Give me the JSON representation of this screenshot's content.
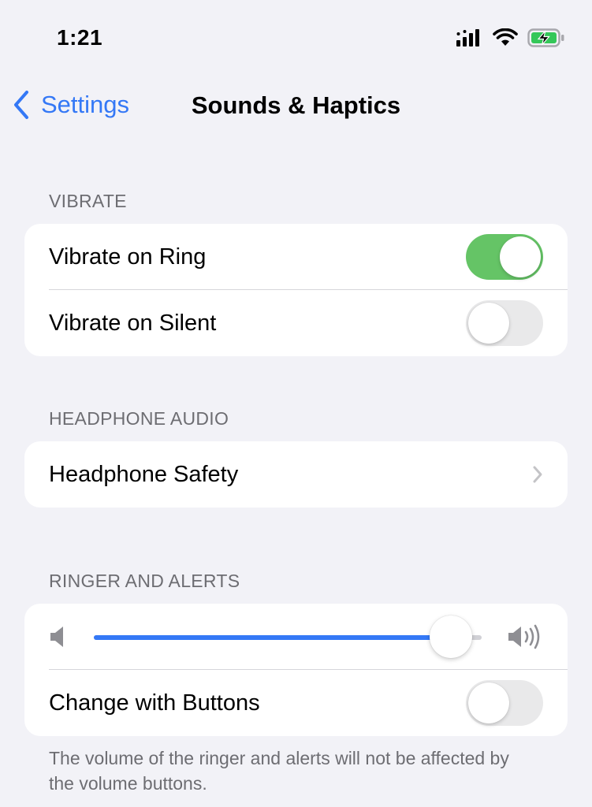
{
  "status_bar": {
    "time": "1:21",
    "icons": [
      "signal-icon",
      "wifi-icon",
      "battery-charging-icon"
    ],
    "battery_color": "#34c759"
  },
  "nav": {
    "back_label": "Settings",
    "title": "Sounds & Haptics"
  },
  "sections": {
    "vibrate": {
      "header": "VIBRATE",
      "rows": [
        {
          "label": "Vibrate on Ring",
          "toggle": true
        },
        {
          "label": "Vibrate on Silent",
          "toggle": false
        }
      ]
    },
    "headphone_audio": {
      "header": "HEADPHONE AUDIO",
      "rows": [
        {
          "label": "Headphone Safety",
          "accessory": "chevron-right-icon"
        }
      ]
    },
    "ringer_and_alerts": {
      "header": "RINGER AND ALERTS",
      "volume_level": 0.92,
      "rows": [
        {
          "label": "Change with Buttons",
          "toggle": false
        }
      ],
      "footer": "The volume of the ringer and alerts will not be affected by the volume buttons."
    }
  },
  "colors": {
    "accent": "#3478f6",
    "toggle_on": "#65c466",
    "toggle_off": "#e9e9ea",
    "background": "#f2f2f7"
  }
}
